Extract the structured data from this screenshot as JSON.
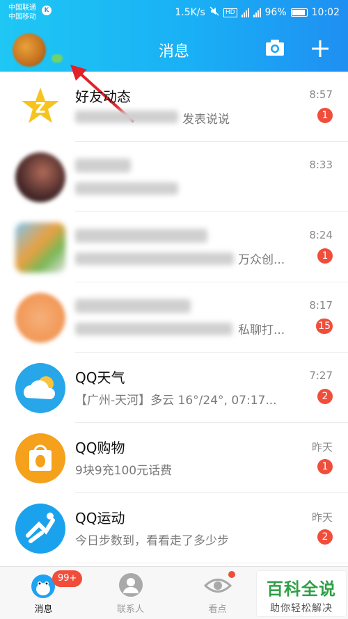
{
  "status_bar": {
    "carrier_1": "中国联通",
    "carrier_2": "中国移动",
    "network_speed": "1.5K/s",
    "hd": "HD",
    "battery": "96%",
    "time": "10:02"
  },
  "header": {
    "title": "消息"
  },
  "messages": [
    {
      "name": "好友动态",
      "preview": "发表说说",
      "time": "8:57",
      "badge": "1",
      "icon": "qzone-star-icon"
    },
    {
      "name": "",
      "preview": "",
      "time": "8:33",
      "badge": "",
      "icon": "contact-avatar"
    },
    {
      "name": "",
      "preview": "万众创...",
      "time": "8:24",
      "badge": "1",
      "icon": "group-avatar"
    },
    {
      "name": "",
      "preview": "私聊打...",
      "time": "8:17",
      "badge": "15",
      "icon": "group-avatar-orange"
    },
    {
      "name": "QQ天气",
      "preview": "【广州-天河】多云 16°/24°, 07:17...",
      "time": "7:27",
      "badge": "2",
      "icon": "weather-cloud-icon"
    },
    {
      "name": "QQ购物",
      "preview": "9块9充100元话费",
      "time": "昨天",
      "badge": "1",
      "icon": "shopping-bag-icon"
    },
    {
      "name": "QQ运动",
      "preview": "今日步数到，看看走了多少步",
      "time": "昨天",
      "badge": "2",
      "icon": "running-icon"
    }
  ],
  "tabs": [
    {
      "label": "消息",
      "badge": "99+"
    },
    {
      "label": "联系人"
    },
    {
      "label": "看点"
    }
  ],
  "watermark": {
    "line1": "百科全说",
    "line2": "助你轻松解决"
  },
  "colors": {
    "header_start": "#1fc7f4",
    "header_end": "#1f8ff2",
    "badge": "#f04d3a"
  }
}
